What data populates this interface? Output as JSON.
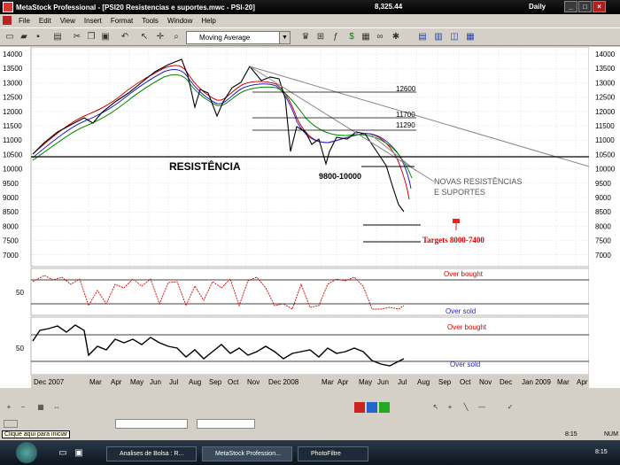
{
  "window": {
    "title": "MetaStock Professional - [PSI20  Resistencias e suportes.mwc - PSI-20]",
    "price": "8,325.44",
    "period": "Daily"
  },
  "menu": [
    "File",
    "Edit",
    "View",
    "Insert",
    "Format",
    "Tools",
    "Window",
    "Help"
  ],
  "toolbar": {
    "indicator_select": "Moving Average"
  },
  "chart": {
    "price_ticks": [
      "14000",
      "13500",
      "13000",
      "12500",
      "12000",
      "11500",
      "11000",
      "10500",
      "10000",
      "9500",
      "9000",
      "8500",
      "8000",
      "7500",
      "7000"
    ],
    "osc1_tick": "50",
    "osc2_tick": "50",
    "x_labels": [
      "Dec 2007",
      "Mar",
      "Apr",
      "May",
      "Jun",
      "Jul",
      "Aug",
      "Sep",
      "Oct",
      "Nov",
      "Dec 2008",
      "Mar",
      "Apr",
      "May",
      "Jun",
      "Jul",
      "Aug",
      "Sep",
      "Oct",
      "Nov",
      "Dec",
      "Jan 2009",
      "Mar",
      "Apr"
    ],
    "annotations": {
      "resistencia": "RESISTÊNCIA",
      "zone": "9800-10000",
      "novas": "NOVAS RESISTÊNCIAS",
      "suportes": "E SUPORTES",
      "targets": "Targets 8000-7400",
      "l12600": "12600",
      "l11700": "11700",
      "l11290": "11290",
      "ob1": "Over bought",
      "os1": "Over sold",
      "ob2": "Over bought",
      "os2": "Over sold"
    }
  },
  "status": {
    "hint": "Clique aqui para iniciar",
    "time": "8:15",
    "num": "NUM"
  },
  "taskbar": {
    "tasks": [
      "Analises de Bolsa : R...",
      "MetaStock Profession...",
      "PhotoFiltre"
    ],
    "clock": "8:15"
  }
}
